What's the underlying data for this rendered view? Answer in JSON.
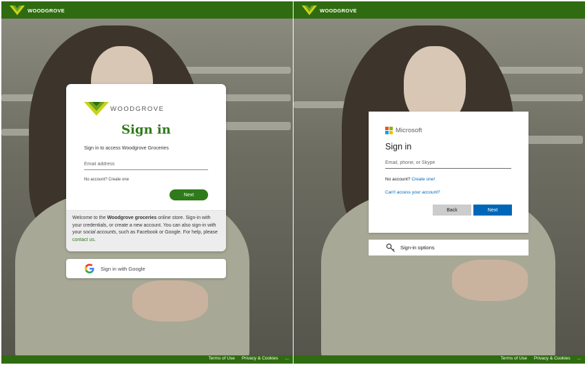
{
  "left_panel": {
    "header": {
      "brand": "WOODGROVE"
    },
    "card": {
      "logo_text": "WOODGROVE",
      "title": "Sign in",
      "subtitle": "Sign in to access Woodgrove Groceries",
      "email_placeholder": "Email address",
      "no_account": "No account?",
      "create_one": "Create one",
      "next_label": "Next",
      "welcome": {
        "part1": "Welcome to the ",
        "bold": "Woodgrove groceries",
        "part2": " online store. Sign-in with your credentials, or create a new account. You can also sign-in with your ",
        "italic": "social accounts",
        "part3": ", such as Facebook or Google. For help, please ",
        "help_link": "contact us",
        "end": "."
      }
    },
    "google_button": "Sign in with Google",
    "footer": {
      "terms": "Terms of Use",
      "privacy": "Privacy & Cookies",
      "more": "..."
    }
  },
  "right_panel": {
    "header": {
      "brand": "WOODGROVE"
    },
    "card": {
      "logo_text": "Microsoft",
      "title": "Sign in",
      "email_placeholder": "Email, phone, or Skype",
      "no_account": "No account?",
      "create_one": "Create one!",
      "cant_access": "Can't access your account?",
      "back_label": "Back",
      "next_label": "Next"
    },
    "signin_options": "Sign-in options",
    "footer": {
      "terms": "Terms of Use",
      "privacy": "Privacy & Cookies",
      "more": "..."
    }
  },
  "colors": {
    "brand_green": "#2f6b10",
    "accent_green": "#2f7a1a",
    "microsoft_blue": "#0067b8"
  },
  "icons": [
    "woodgrove-logo-icon",
    "google-logo-icon",
    "microsoft-logo-icon",
    "key-icon"
  ]
}
